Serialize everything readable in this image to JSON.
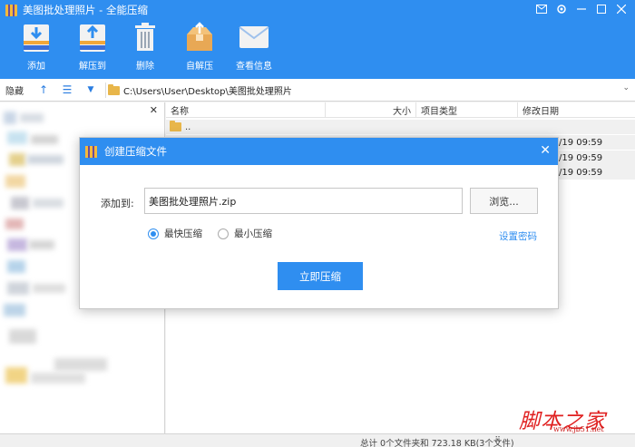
{
  "window": {
    "title": "美图批处理照片 - 全能压缩",
    "controls": [
      "mail-icon",
      "settings-icon",
      "minimize-icon",
      "maximize-icon",
      "close-icon"
    ]
  },
  "toolbar": {
    "add_label": "添加",
    "extract_label": "解压到",
    "delete_label": "删除",
    "selfextract_label": "自解压",
    "view_label": "查看信息"
  },
  "addressbar": {
    "hide_label": "隐藏",
    "path": "C:\\Users\\User\\Desktop\\美图批处理照片"
  },
  "filelist": {
    "columns": {
      "name": "名称",
      "size": "大小",
      "type": "项目类型",
      "modified": "修改日期"
    },
    "parent_label": "..",
    "rows": [
      {
        "modified": "/19  09:59"
      },
      {
        "modified": "/19  09:59"
      },
      {
        "modified": "/19  09:59"
      }
    ]
  },
  "dialog": {
    "title": "创建压缩文件",
    "addto_label": "添加到:",
    "dest_value": "美图批处理照片.zip",
    "browse_label": "浏览...",
    "option_fast": "最快压缩",
    "option_small": "最小压缩",
    "set_password_label": "设置密码",
    "submit_label": "立即压缩"
  },
  "status": {
    "summary": "总计 0个文件夹和 723.18 KB(3个文件)"
  },
  "watermark": {
    "main": "脚本之家",
    "sub": "www.jb51.net"
  },
  "colors": {
    "accent": "#2f8ef0",
    "watermark": "#e02020"
  }
}
